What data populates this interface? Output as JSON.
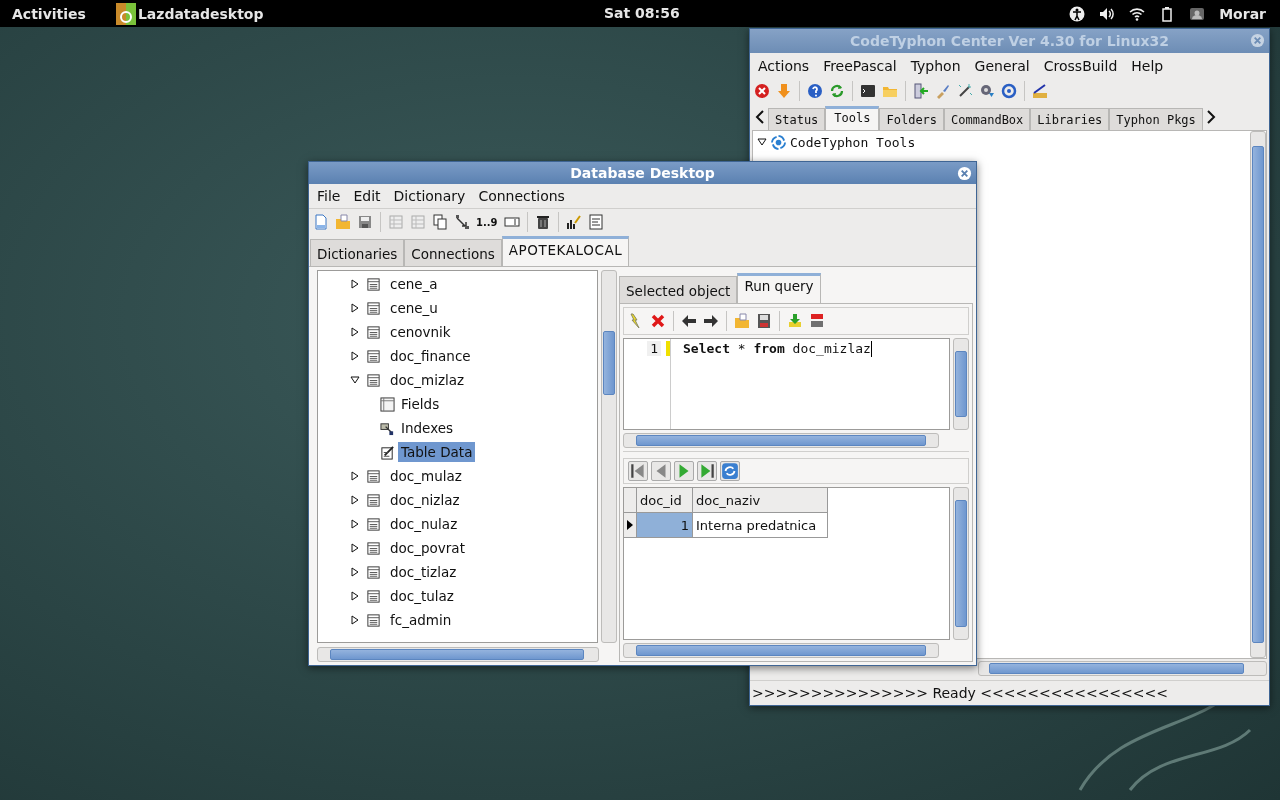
{
  "top_bar": {
    "activities": "Activities",
    "app_name": "Lazdatadesktop",
    "clock": "Sat 08:56",
    "user": "Morar"
  },
  "codetyphon": {
    "title": "CodeTyphon Center Ver 4.30 for Linux32",
    "menu": [
      "Actions",
      "FreePascal",
      "Typhon",
      "General",
      "CrossBuild",
      "Help"
    ],
    "tabs": [
      {
        "label": "Status",
        "selected": false
      },
      {
        "label": "Tools",
        "selected": true
      },
      {
        "label": "Folders",
        "selected": false
      },
      {
        "label": "CommandBox",
        "selected": false
      },
      {
        "label": "Libraries",
        "selected": false
      },
      {
        "label": "Typhon Pkgs",
        "selected": false
      }
    ],
    "tree": [
      {
        "label": "CodeTyphon Tools",
        "expanded": true
      }
    ],
    "status": ">>>>>>>>>>>>>>> Ready <<<<<<<<<<<<<<<<"
  },
  "db": {
    "title": "Database Desktop",
    "menu": [
      "File",
      "Edit",
      "Dictionary",
      "Connections"
    ],
    "toolbar_glyph": "1..9",
    "tabs": [
      {
        "label": "Dictionaries",
        "selected": false
      },
      {
        "label": "Connections",
        "selected": false
      },
      {
        "label": "APOTEKALOCAL",
        "selected": true
      }
    ],
    "tree": [
      {
        "label": "cene_a",
        "expanded": false
      },
      {
        "label": "cene_u",
        "expanded": false
      },
      {
        "label": "cenovnik",
        "expanded": false
      },
      {
        "label": "doc_finance",
        "expanded": false
      },
      {
        "label": "doc_mizlaz",
        "expanded": true,
        "children": [
          {
            "label": "Fields",
            "kind": "fields",
            "selected": false
          },
          {
            "label": "Indexes",
            "kind": "indexes",
            "selected": false
          },
          {
            "label": "Table Data",
            "kind": "data",
            "selected": true
          }
        ]
      },
      {
        "label": "doc_mulaz",
        "expanded": false
      },
      {
        "label": "doc_nizlaz",
        "expanded": false
      },
      {
        "label": "doc_nulaz",
        "expanded": false
      },
      {
        "label": "doc_povrat",
        "expanded": false
      },
      {
        "label": "doc_tizlaz",
        "expanded": false
      },
      {
        "label": "doc_tulaz",
        "expanded": false
      },
      {
        "label": "fc_admin",
        "expanded": false
      }
    ],
    "query_tabs": [
      {
        "label": "Selected object",
        "selected": false
      },
      {
        "label": "Run query",
        "selected": true
      }
    ],
    "editor": {
      "line_number": "1",
      "sql": "**Select** * **from** doc_mizlaz"
    },
    "grid": {
      "columns": [
        "doc_id",
        "doc_naziv"
      ],
      "rows": [
        {
          "cells": [
            "1",
            "Interna predatnica"
          ],
          "selected": true
        }
      ]
    }
  }
}
